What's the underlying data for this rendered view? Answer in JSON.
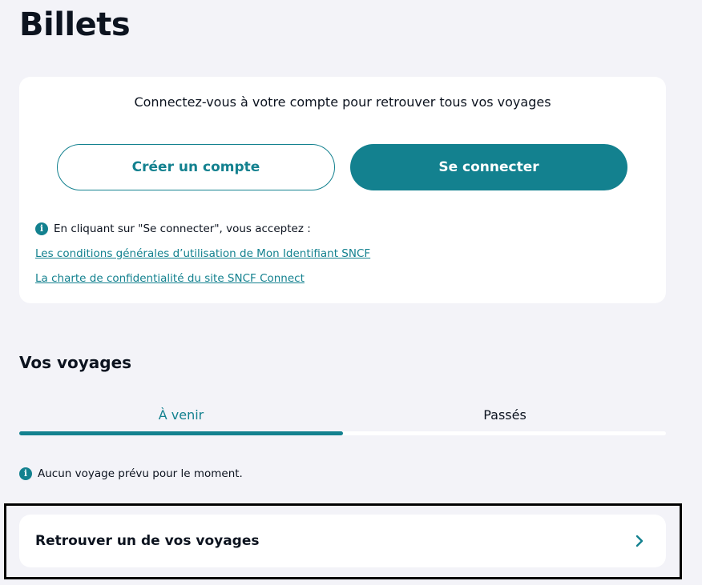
{
  "page": {
    "title": "Billets"
  },
  "login_card": {
    "prompt": "Connectez-vous à votre compte pour retrouver tous vos voyages",
    "create_account_label": "Créer un compte",
    "login_label": "Se connecter",
    "terms_note": "En cliquant sur \"Se connecter\", vous acceptez :",
    "terms_link_1": "Les conditions générales d’utilisation de Mon Identifiant SNCF",
    "terms_link_2": "La charte de confidentialité du site SNCF Connect",
    "info_icon": "info-icon"
  },
  "trips": {
    "section_title": "Vos voyages",
    "tabs": [
      {
        "label": "À venir",
        "selected": true
      },
      {
        "label": "Passés",
        "selected": false
      }
    ],
    "empty_message": "Aucun voyage prévu pour le moment.",
    "find_trip_label": "Retrouver un de vos voyages",
    "find_trip_icon": "chevron-right-icon"
  },
  "colors": {
    "accent": "#13818f",
    "background": "#f3f3f8",
    "card": "#ffffff",
    "text": "#0c131f"
  }
}
